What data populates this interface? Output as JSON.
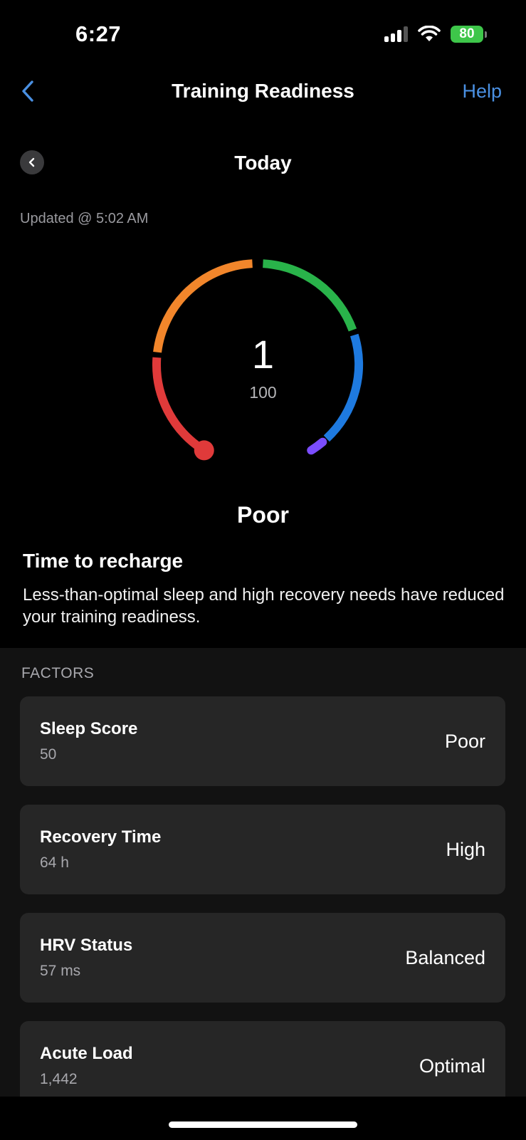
{
  "status_bar": {
    "time": "6:27",
    "battery": "80"
  },
  "nav": {
    "title": "Training Readiness",
    "help": "Help"
  },
  "date": {
    "label": "Today"
  },
  "updated": "Updated @ 5:02 AM",
  "gauge": {
    "value": "1",
    "max": "100",
    "score": 1,
    "range": [
      1,
      100
    ],
    "colors": [
      "#e03a3a",
      "#f2862b",
      "#29b34a",
      "#1e7ae0",
      "#7b4dff"
    ]
  },
  "level": "Poor",
  "message": {
    "title": "Time to recharge",
    "body": "Less-than-optimal sleep and high recovery needs have reduced your training readiness."
  },
  "factors": {
    "title": "FACTORS",
    "items": [
      {
        "name": "Sleep Score",
        "value": "50",
        "status": "Poor"
      },
      {
        "name": "Recovery Time",
        "value": "64 h",
        "status": "High"
      },
      {
        "name": "HRV Status",
        "value": "57 ms",
        "status": "Balanced"
      },
      {
        "name": "Acute Load",
        "value": "1,442",
        "status": "Optimal"
      }
    ]
  }
}
